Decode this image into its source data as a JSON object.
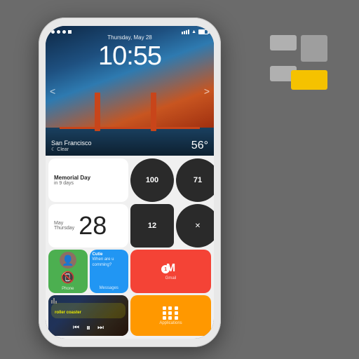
{
  "logo": {
    "blocks": [
      "top-right-gray",
      "top-left-lighter-gray",
      "bottom-left-lighter-gray",
      "bottom-right-yellow"
    ]
  },
  "phone": {
    "status_bar": {
      "left_icons": [
        "circle",
        "circle",
        "circle",
        "square"
      ],
      "time": "10:55",
      "right_icons": [
        "signal",
        "wifi",
        "battery"
      ]
    },
    "hero": {
      "date_label": "Thursday, May 28",
      "time": "10:55",
      "city": "San Francisco",
      "condition": "Clear",
      "temperature": "56°"
    },
    "widgets": {
      "memorial": {
        "title": "Memorial Day",
        "subtitle": "in 9 days"
      },
      "circle1": {
        "number": "100",
        "unit": ""
      },
      "circle2": {
        "number": "71",
        "unit": ""
      },
      "date_widget": {
        "month": "May",
        "weekday": "Thursday",
        "day": "28"
      },
      "circle3": {
        "number": "12"
      },
      "phone_app": {
        "label": "Phone"
      },
      "messages_app": {
        "from": "Cutie",
        "text": "When are u comming?",
        "label": "Messages"
      },
      "gmail_app": {
        "label": "Gmail",
        "badge": "1"
      },
      "music": {
        "track": "roller coaster",
        "play_btn": "⏸",
        "prev_btn": "⏮",
        "next_btn": "⏭"
      },
      "applications": {
        "label": "Applications"
      }
    }
  }
}
